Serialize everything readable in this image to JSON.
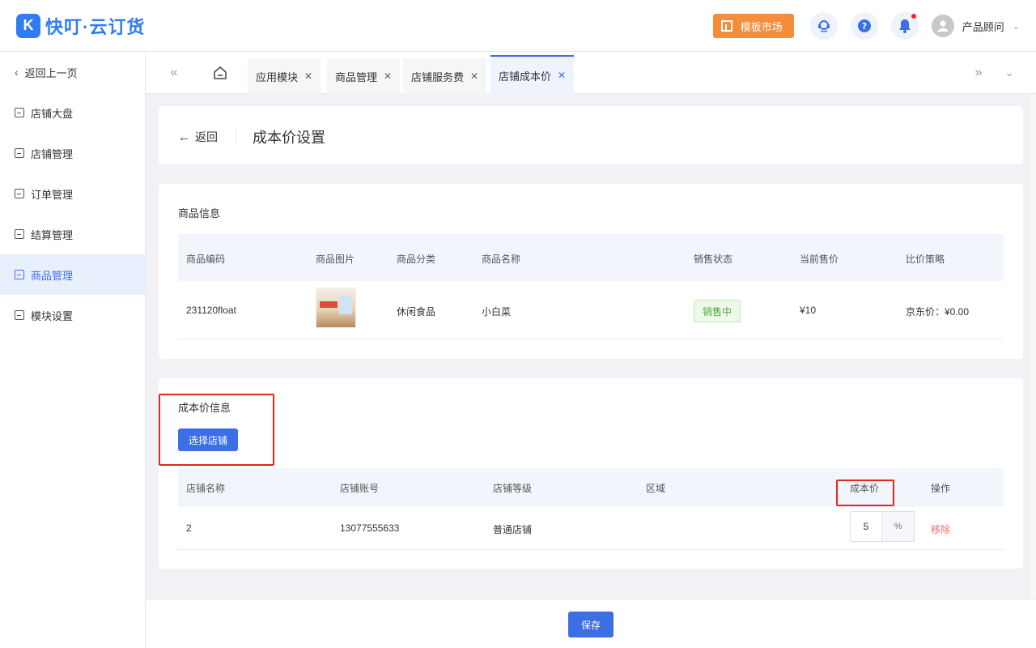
{
  "header": {
    "app_name": "快叮·云订货",
    "market_label": "模板市场",
    "user_name": "产品顾问",
    "icons": [
      "support-icon",
      "help-icon",
      "bell-icon"
    ]
  },
  "sidebar": {
    "back_label": "返回上一页",
    "items": [
      {
        "label": "店铺大盘"
      },
      {
        "label": "店铺管理"
      },
      {
        "label": "订单管理"
      },
      {
        "label": "结算管理"
      },
      {
        "label": "商品管理"
      },
      {
        "label": "模块设置"
      }
    ],
    "active": "商品管理"
  },
  "tabs": [
    {
      "label": "应用模块"
    },
    {
      "label": "商品管理"
    },
    {
      "label": "店铺服务费"
    },
    {
      "label": "店铺成本价"
    }
  ],
  "page": {
    "back_label": "返回",
    "title": "成本价设置"
  },
  "product_info": {
    "title": "商品信息",
    "columns": [
      "商品编码",
      "商品图片",
      "商品分类",
      "商品名称",
      "销售状态",
      "当前售价",
      "比价策略"
    ],
    "row": {
      "code": "231120float",
      "category": "休闲食品",
      "name": "小白菜",
      "status": "销售中",
      "price": "¥10",
      "strategy": "京东价：¥0.00"
    }
  },
  "cost_info": {
    "title": "成本价信息",
    "select_store_label": "选择店铺",
    "columns": [
      "店铺名称",
      "店铺账号",
      "店铺等级",
      "区域",
      "成本价",
      "操作"
    ],
    "rows": [
      {
        "store_name": "2",
        "account": "13077555633",
        "level": "普通店铺",
        "region": "",
        "cost_value": "5",
        "cost_unit": "%",
        "action": "移除"
      }
    ]
  },
  "footer": {
    "save_label": "保存"
  },
  "colors": {
    "primary": "#3b6fe3",
    "market": "#f58d3a",
    "status_green": "#52a83a",
    "danger": "#f56c6c",
    "highlight_box": "#e5261f"
  }
}
